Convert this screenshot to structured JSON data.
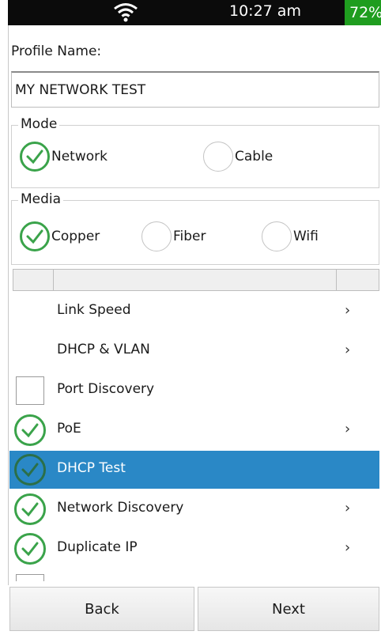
{
  "status_bar": {
    "time": "10:27 am",
    "battery": "72%",
    "battery_color": "#1f9d1f",
    "wifi_icon": "wifi-icon"
  },
  "profile": {
    "label": "Profile Name:",
    "value": "MY NETWORK TEST"
  },
  "mode": {
    "title": "Mode",
    "options": [
      {
        "label": "Network",
        "checked": true
      },
      {
        "label": "Cable",
        "checked": false
      }
    ]
  },
  "media": {
    "title": "Media",
    "options": [
      {
        "label": "Copper",
        "checked": true
      },
      {
        "label": "Fiber",
        "checked": false
      },
      {
        "label": "Wifi",
        "checked": false
      }
    ]
  },
  "tests": [
    {
      "label": "Link Speed",
      "state": "none",
      "has_submenu": true
    },
    {
      "label": "DHCP & VLAN",
      "state": "none",
      "has_submenu": true
    },
    {
      "label": "Port Discovery",
      "state": "unchecked",
      "has_submenu": false
    },
    {
      "label": "PoE",
      "state": "checked",
      "has_submenu": true
    },
    {
      "label": "DHCP Test",
      "state": "checked",
      "has_submenu": false,
      "selected": true
    },
    {
      "label": "Network Discovery",
      "state": "checked",
      "has_submenu": true
    },
    {
      "label": "Duplicate IP",
      "state": "checked",
      "has_submenu": true
    },
    {
      "label": "",
      "state": "unchecked",
      "has_submenu": false
    }
  ],
  "chevron": "›",
  "footer": {
    "back_label": "Back",
    "next_label": "Next"
  },
  "colors": {
    "check_green": "#3aa34a",
    "selected_row": "#2a88c6"
  }
}
